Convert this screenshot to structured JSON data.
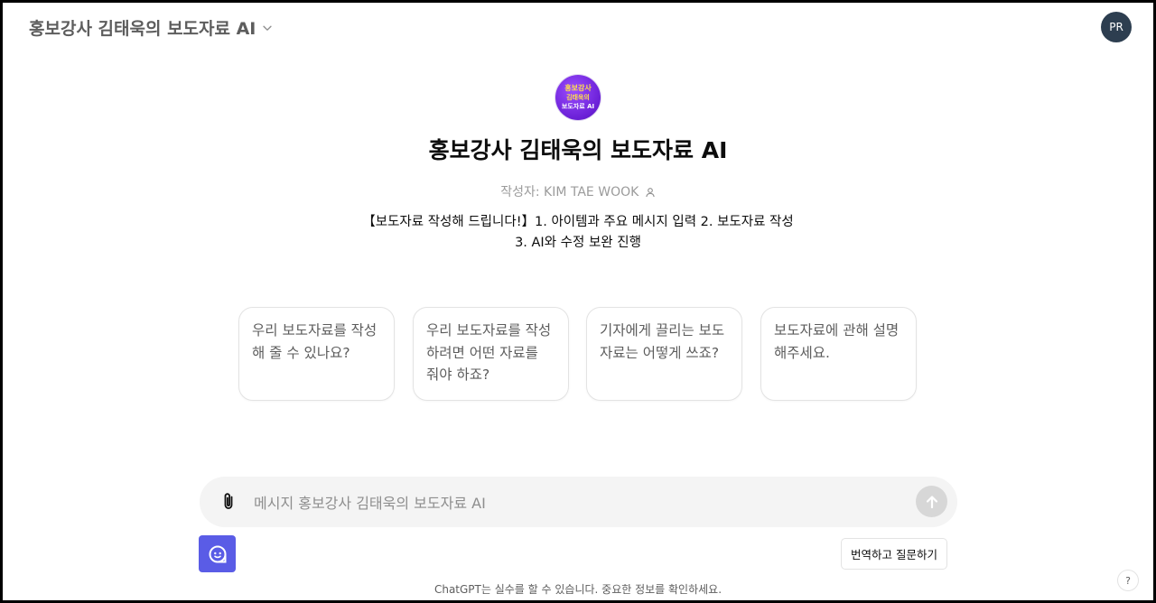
{
  "header": {
    "title": "홍보강사 김태욱의 보도자료 AI",
    "dropdown_icon": "chevron-down-icon"
  },
  "user": {
    "initials": "PR",
    "color": "#2d3e50"
  },
  "gpt": {
    "logo": {
      "line1": "홍보강사",
      "line2": "김태욱의",
      "line3": "보도자료 AI",
      "colors": {
        "background": "#7a2ef0",
        "accent": "#ffe04a"
      }
    },
    "title": "홍보강사 김태욱의 보도자료 AI",
    "author_prefix": "작성자:",
    "author_name": "KIM TAE WOOK",
    "author_icon": "user-icon",
    "description": "【보도자료 작성해 드립니다!】1. 아이템과 주요 메시지 입력 2. 보도자료 작성 3. AI와 수정 보완 진행"
  },
  "suggestions": [
    {
      "text": "우리 보도자료를 작성해 줄 수 있나요?"
    },
    {
      "text": "우리 보도자료를 작성하려면 어떤 자료를 줘야 하죠?"
    },
    {
      "text": "기자에게 끌리는 보도자료는 어떻게 쓰죠?"
    },
    {
      "text": "보도자료에 관해 설명해주세요."
    }
  ],
  "composer": {
    "placeholder": "메시지 홍보강사 김태욱의 보도자료 AI",
    "attach_icon": "paperclip-icon",
    "send_icon": "arrow-up-icon"
  },
  "extension": {
    "icon": "chat-bubble-icon",
    "color": "#5a5ce6",
    "translate_label": "번역하고 질문하기"
  },
  "footer": {
    "disclaimer": "ChatGPT는 실수를 할 수 있습니다. 중요한 정보를 확인하세요.",
    "help_label": "?"
  }
}
